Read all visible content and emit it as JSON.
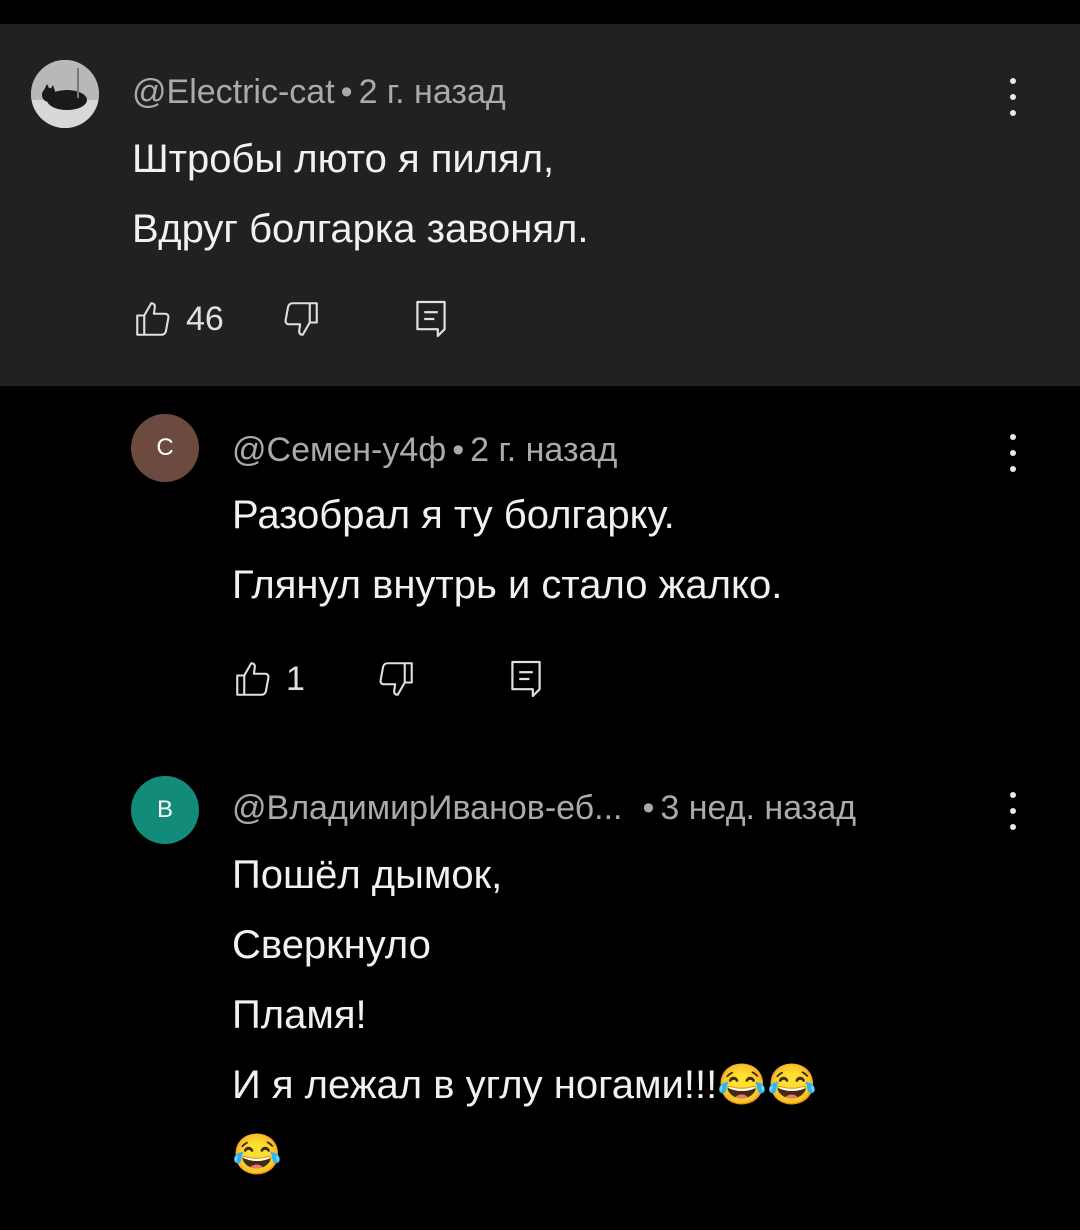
{
  "comments": [
    {
      "author": "@Electric-cat",
      "age": "2 г. назад",
      "lines": [
        "Штробы люто я пилял,",
        "Вдруг болгарка завонял."
      ],
      "likes": "46"
    },
    {
      "avatar_letter": "С",
      "author": "@Семен-у4ф",
      "age": "2 г. назад",
      "lines": [
        "Разобрал я ту болгарку.",
        "Глянул внутрь и стало жалко."
      ],
      "likes": "1"
    },
    {
      "avatar_letter": "В",
      "author": "@ВладимирИванов-еб...",
      "age": "3 нед. назад",
      "lines": [
        "Пошёл дымок,",
        "Сверкнуло",
        "Пламя!",
        "И я лежал в углу ногами!!!"
      ],
      "emoji": "😂"
    }
  ],
  "dot": "•",
  "icons": {
    "like": "thumb-up-icon",
    "dislike": "thumb-down-icon",
    "reply": "reply-comment-icon",
    "more": "more-vert-icon"
  },
  "colors": {
    "main_bg": "#212121",
    "avatar_s": "#6d4a3f",
    "avatar_v": "#128b78"
  }
}
